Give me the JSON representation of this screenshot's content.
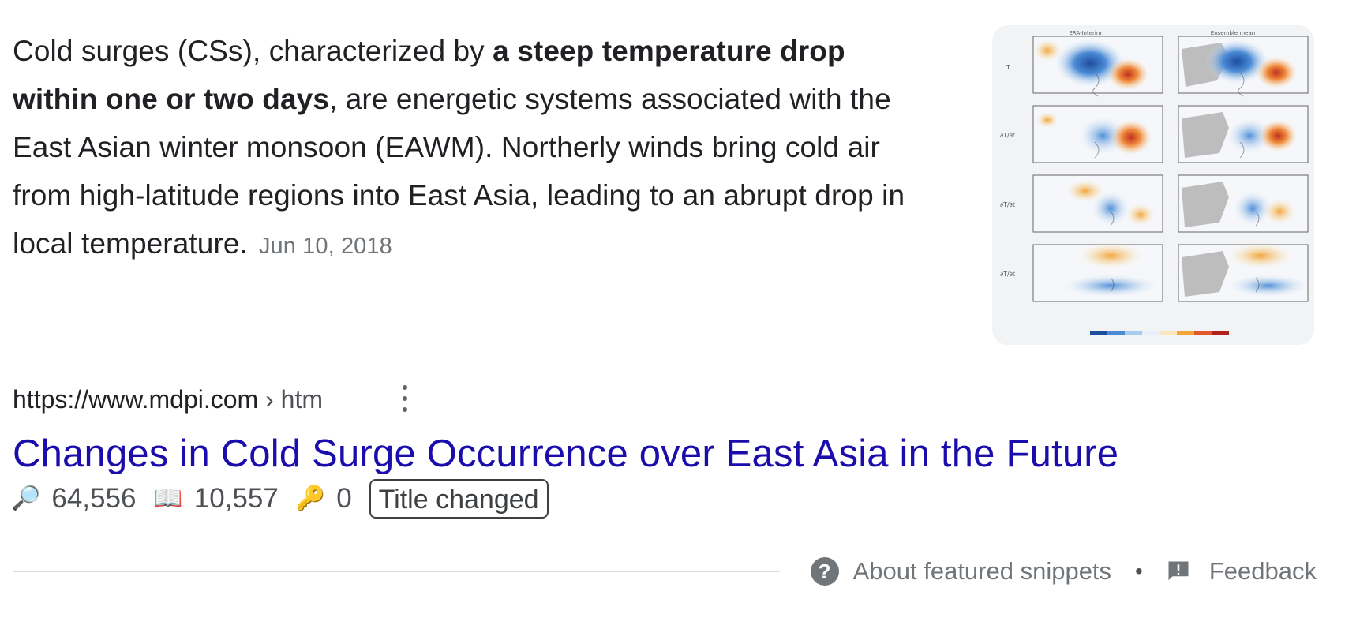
{
  "snippet": {
    "part1": "Cold surges (CSs), characterized by ",
    "bold": "a steep temperature drop within one or two days",
    "part2": ", are energetic systems associated with the East Asian winter monsoon (EAWM). Northerly winds bring cold air from high-latitude regions into East Asia, leading to an abrupt drop in local temperature.",
    "date": "Jun 10, 2018"
  },
  "thumbnail": {
    "panel_headers": [
      "ERA-Interim",
      "Ensemble mean"
    ],
    "row_labels": [
      "T",
      "∂T/∂t",
      "∂T/∂t",
      "∂T/∂t"
    ]
  },
  "result": {
    "url": "https://www.mdpi.com",
    "separator": "›",
    "path": "htm",
    "title": "Changes in Cold Surge Occurrence over East Asia in the Future"
  },
  "stats": {
    "views_icon": "magnifier-icon",
    "views": "64,556",
    "reads_icon": "open-book-icon",
    "reads": "10,557",
    "keys_icon": "key-icon",
    "keys": "0",
    "badge": "Title changed"
  },
  "footer": {
    "about_label": "About featured snippets",
    "separator": "•",
    "feedback_label": "Feedback"
  },
  "colors": {
    "link": "#1a0dab",
    "text": "#202124",
    "muted": "#70757a"
  }
}
